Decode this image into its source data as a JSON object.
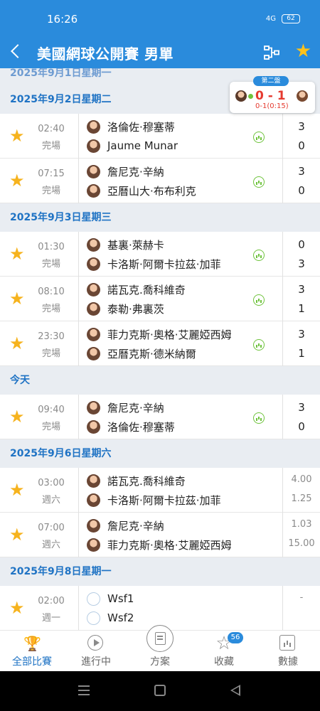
{
  "status_bar": {
    "time": "16:26",
    "network": "4G",
    "battery": "62"
  },
  "header": {
    "title": "美國網球公開賽 男單"
  },
  "live_card": {
    "label": "第二盤",
    "score": "0 - 1",
    "sub": "0-1(0:15)"
  },
  "sections": [
    {
      "date": "2025年9月1日星期一",
      "partial": true,
      "matches": []
    },
    {
      "date": "2025年9月2日星期二",
      "matches": [
        {
          "time": "02:40",
          "status": "完場",
          "p1": "洛倫佐·穆塞蒂",
          "p2": "Jaume Munar",
          "s1": "3",
          "s2": "0",
          "stats": true
        },
        {
          "time": "07:15",
          "status": "完場",
          "p1": "詹尼克·辛納",
          "p2": "亞曆山大·布布利克",
          "s1": "3",
          "s2": "0",
          "stats": true
        }
      ]
    },
    {
      "date": "2025年9月3日星期三",
      "matches": [
        {
          "time": "01:30",
          "status": "完場",
          "p1": "基裏·萊赫卡",
          "p2": "卡洛斯·阿爾卡拉茲·加菲",
          "s1": "0",
          "s2": "3",
          "stats": true
        },
        {
          "time": "08:10",
          "status": "完場",
          "p1": "諾瓦克.喬科維奇",
          "p2": "泰勒·弗裏茨",
          "s1": "3",
          "s2": "1",
          "stats": true
        },
        {
          "time": "23:30",
          "status": "完場",
          "p1": "菲力克斯·奧格·艾麗婭西姆",
          "p2": "亞曆克斯·德米納爾",
          "s1": "3",
          "s2": "1",
          "stats": true
        }
      ]
    },
    {
      "date": "今天",
      "matches": [
        {
          "time": "09:40",
          "status": "完場",
          "p1": "詹尼克·辛納",
          "p2": "洛倫佐·穆塞蒂",
          "s1": "3",
          "s2": "0",
          "stats": true
        }
      ]
    },
    {
      "date": "2025年9月6日星期六",
      "matches": [
        {
          "time": "03:00",
          "status": "週六",
          "p1": "諾瓦克.喬科維奇",
          "p2": "卡洛斯·阿爾卡拉茲·加菲",
          "s1": "4.00",
          "s2": "1.25",
          "odds": true
        },
        {
          "time": "07:00",
          "status": "週六",
          "p1": "詹尼克·辛納",
          "p2": "菲力克斯·奧格·艾麗婭西姆",
          "s1": "1.03",
          "s2": "15.00",
          "odds": true
        }
      ]
    },
    {
      "date": "2025年9月8日星期一",
      "matches": [
        {
          "time": "02:00",
          "status": "週一",
          "p1": "Wsf1",
          "p2": "Wsf2",
          "s1": "-",
          "s2": "",
          "odds": true,
          "blank": true
        }
      ]
    }
  ],
  "tabs": [
    {
      "label": "全部比賽",
      "icon": "trophy-icon",
      "active": true
    },
    {
      "label": "進行中",
      "icon": "play-icon"
    },
    {
      "label": "方案",
      "icon": "plan-icon"
    },
    {
      "label": "收藏",
      "icon": "star-icon",
      "badge": "56"
    },
    {
      "label": "數據",
      "icon": "chart-icon"
    }
  ],
  "colors": {
    "primary": "#2a8bdc",
    "date_text": "#1f73c4",
    "star": "#f6b31e",
    "live_red": "#e53a2f",
    "stats_green": "#6fc33d"
  }
}
